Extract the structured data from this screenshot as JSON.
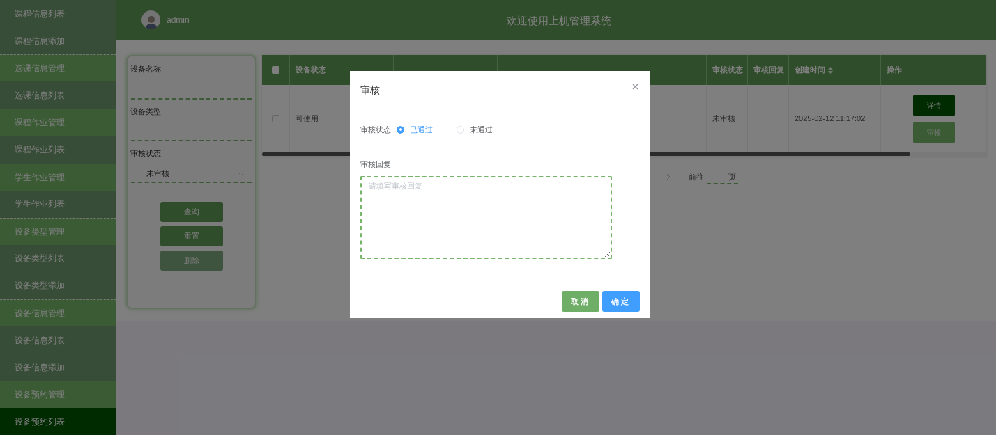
{
  "sidebar": {
    "items": [
      {
        "label": "课程信息列表",
        "kind": "item",
        "selected": false
      },
      {
        "label": "课程信息添加",
        "kind": "item",
        "selected": false
      },
      {
        "label": "选课信息管理",
        "kind": "group",
        "selected": false
      },
      {
        "label": "选课信息列表",
        "kind": "item",
        "selected": false
      },
      {
        "label": "课程作业管理",
        "kind": "group",
        "selected": false
      },
      {
        "label": "课程作业列表",
        "kind": "item",
        "selected": false
      },
      {
        "label": "学生作业管理",
        "kind": "group",
        "selected": false
      },
      {
        "label": "学生作业列表",
        "kind": "item",
        "selected": false
      },
      {
        "label": "设备类型管理",
        "kind": "group",
        "selected": false
      },
      {
        "label": "设备类型列表",
        "kind": "item",
        "selected": false
      },
      {
        "label": "设备类型添加",
        "kind": "item",
        "selected": false
      },
      {
        "label": "设备信息管理",
        "kind": "group",
        "selected": false
      },
      {
        "label": "设备信息列表",
        "kind": "item",
        "selected": false
      },
      {
        "label": "设备信息添加",
        "kind": "item",
        "selected": false
      },
      {
        "label": "设备预约管理",
        "kind": "group",
        "selected": false
      },
      {
        "label": "设备预约列表",
        "kind": "item",
        "selected": true
      }
    ]
  },
  "header": {
    "username": "admin",
    "title": "欢迎使用上机管理系统"
  },
  "search": {
    "fields": [
      {
        "label": "设备名称",
        "kind": "text"
      },
      {
        "label": "设备类型",
        "kind": "text"
      },
      {
        "label": "审核状态",
        "kind": "select",
        "value": "未审核"
      }
    ],
    "buttons": [
      {
        "label": "查询",
        "disabled": false
      },
      {
        "label": "重置",
        "disabled": false
      },
      {
        "label": "删除",
        "disabled": true
      }
    ]
  },
  "table": {
    "all_checked": false,
    "columns": [
      {
        "label": "设备状态",
        "sortable": false
      },
      {
        "label": "审核状态",
        "sortable": false
      },
      {
        "label": "审核回复",
        "sortable": false
      },
      {
        "label": "创建时间",
        "sortable": true
      },
      {
        "label": "操作",
        "sortable": false
      }
    ],
    "rows": [
      {
        "checked": false,
        "device_status": "可使用",
        "audit_status": "未审核",
        "created_at": "2025-02-12 11:17:02",
        "actions": [
          {
            "label": "详情",
            "kind": "primary"
          },
          {
            "label": "审核",
            "kind": "secondary"
          }
        ]
      }
    ]
  },
  "pagination": {
    "goto_label": "前往",
    "page_suffix": "页"
  },
  "dialog": {
    "title": "审核",
    "status_label": "审核状态",
    "options": [
      {
        "label": "已通过",
        "selected": true
      },
      {
        "label": "未通过",
        "selected": false
      }
    ],
    "reply_label": "审核回复",
    "reply_placeholder": "请填写审核回复",
    "buttons": [
      {
        "label": "取消",
        "kind": "cancel"
      },
      {
        "label": "确定",
        "kind": "confirm"
      }
    ]
  }
}
